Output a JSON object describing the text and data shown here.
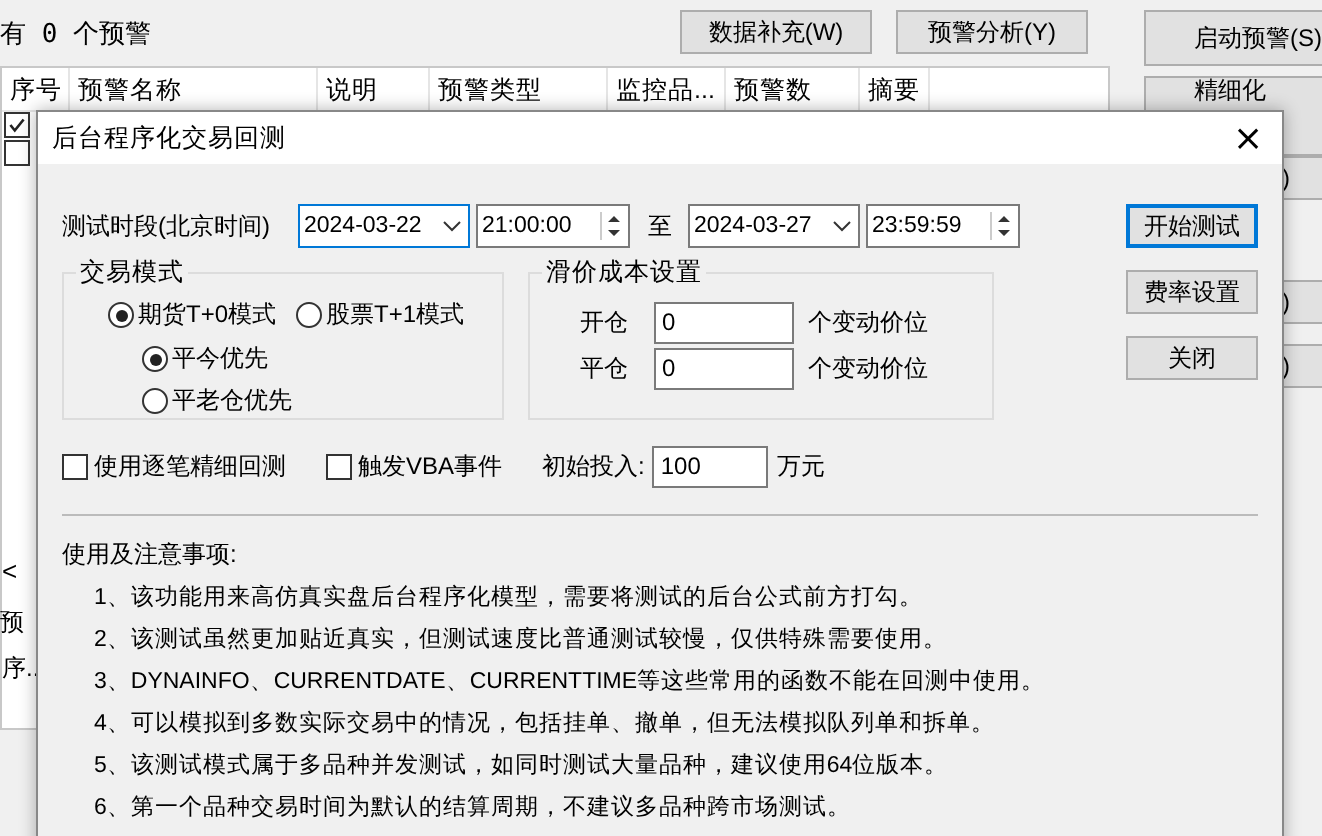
{
  "background": {
    "alert_count": "有 0 个预警",
    "buttons": [
      "数据补充(W)",
      "预警分析(Y)"
    ],
    "side_buttons": [
      "启动预警(S)",
      "精细化",
      ")",
      ")",
      ")"
    ],
    "table": {
      "columns": [
        "序号",
        "预警名称",
        "说明",
        "预警类型",
        "监控品...",
        "预警数",
        "摘要"
      ],
      "rows": [
        {
          "checked": true
        },
        {
          "checked": false
        }
      ]
    },
    "scroll_arrow": "<",
    "lower_tab": "预",
    "lower_column": "序.."
  },
  "dialog": {
    "title": "后台程序化交易回测",
    "close": "×",
    "period_label": "测试时段(北京时间)",
    "start_date": "2024-03-22",
    "start_time": "21:00:00",
    "to": "至",
    "end_date": "2024-03-27",
    "end_time": "23:59:59",
    "buttons": [
      {
        "label": "开始测试",
        "default": true
      },
      {
        "label": "费率设置",
        "default": false
      },
      {
        "label": "关闭",
        "default": false
      }
    ],
    "trade_mode": {
      "title": "交易模式",
      "modes": [
        {
          "label": "期货T+0模式",
          "selected": true
        },
        {
          "label": "股票T+1模式",
          "selected": false
        }
      ],
      "close_priority": [
        {
          "label": "平今优先",
          "selected": true
        },
        {
          "label": "平老仓优先",
          "selected": false
        }
      ]
    },
    "slippage": {
      "title": "滑价成本设置",
      "rows": [
        {
          "label": "开仓",
          "value": "0",
          "unit": "个变动价位"
        },
        {
          "label": "平仓",
          "value": "0",
          "unit": "个变动价位"
        }
      ]
    },
    "options": [
      {
        "label": "使用逐笔精细回测",
        "checked": false
      },
      {
        "label": "触发VBA事件",
        "checked": false
      }
    ],
    "initial": {
      "label": "初始投入:",
      "value": "100",
      "unit": "万元"
    },
    "notes": {
      "title": "使用及注意事项:",
      "items": [
        "1、该功能用来高仿真实盘后台程序化模型，需要将测试的后台公式前方打勾。",
        "2、该测试虽然更加贴近真实，但测试速度比普通测试较慢，仅供特殊需要使用。",
        "3、DYNAINFO、CURRENTDATE、CURRENTTIME等这些常用的函数不能在回测中使用。",
        "4、可以模拟到多数实际交易中的情况，包括挂单、撤单，但无法模拟队列单和拆单。",
        "5、该测试模式属于多品种并发测试，如同时测试大量品种，建议使用64位版本。",
        "6、第一个品种交易时间为默认的结算周期，不建议多品种跨市场测试。"
      ]
    }
  }
}
